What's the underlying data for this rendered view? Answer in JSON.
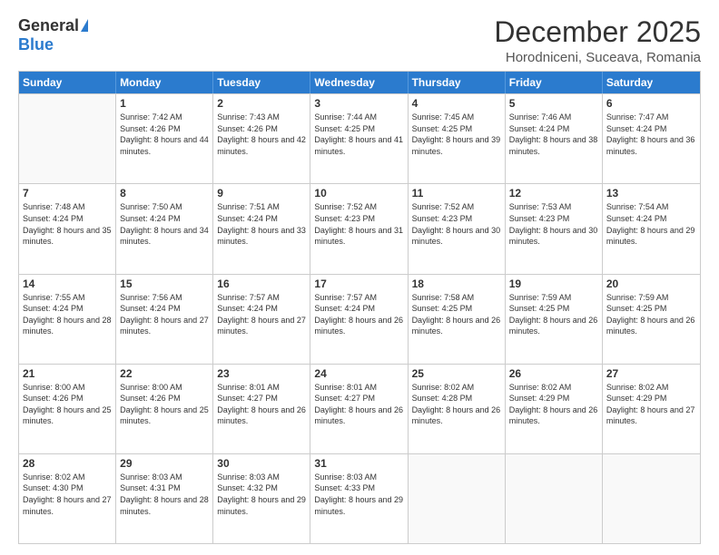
{
  "logo": {
    "general": "General",
    "blue": "Blue"
  },
  "title": "December 2025",
  "subtitle": "Horodniceni, Suceava, Romania",
  "days": [
    "Sunday",
    "Monday",
    "Tuesday",
    "Wednesday",
    "Thursday",
    "Friday",
    "Saturday"
  ],
  "weeks": [
    [
      {
        "day": "",
        "sunrise": "",
        "sunset": "",
        "daylight": ""
      },
      {
        "day": "1",
        "sunrise": "7:42 AM",
        "sunset": "4:26 PM",
        "daylight": "8 hours and 44 minutes."
      },
      {
        "day": "2",
        "sunrise": "7:43 AM",
        "sunset": "4:26 PM",
        "daylight": "8 hours and 42 minutes."
      },
      {
        "day": "3",
        "sunrise": "7:44 AM",
        "sunset": "4:25 PM",
        "daylight": "8 hours and 41 minutes."
      },
      {
        "day": "4",
        "sunrise": "7:45 AM",
        "sunset": "4:25 PM",
        "daylight": "8 hours and 39 minutes."
      },
      {
        "day": "5",
        "sunrise": "7:46 AM",
        "sunset": "4:24 PM",
        "daylight": "8 hours and 38 minutes."
      },
      {
        "day": "6",
        "sunrise": "7:47 AM",
        "sunset": "4:24 PM",
        "daylight": "8 hours and 36 minutes."
      }
    ],
    [
      {
        "day": "7",
        "sunrise": "7:48 AM",
        "sunset": "4:24 PM",
        "daylight": "8 hours and 35 minutes."
      },
      {
        "day": "8",
        "sunrise": "7:50 AM",
        "sunset": "4:24 PM",
        "daylight": "8 hours and 34 minutes."
      },
      {
        "day": "9",
        "sunrise": "7:51 AM",
        "sunset": "4:24 PM",
        "daylight": "8 hours and 33 minutes."
      },
      {
        "day": "10",
        "sunrise": "7:52 AM",
        "sunset": "4:23 PM",
        "daylight": "8 hours and 31 minutes."
      },
      {
        "day": "11",
        "sunrise": "7:52 AM",
        "sunset": "4:23 PM",
        "daylight": "8 hours and 30 minutes."
      },
      {
        "day": "12",
        "sunrise": "7:53 AM",
        "sunset": "4:23 PM",
        "daylight": "8 hours and 30 minutes."
      },
      {
        "day": "13",
        "sunrise": "7:54 AM",
        "sunset": "4:24 PM",
        "daylight": "8 hours and 29 minutes."
      }
    ],
    [
      {
        "day": "14",
        "sunrise": "7:55 AM",
        "sunset": "4:24 PM",
        "daylight": "8 hours and 28 minutes."
      },
      {
        "day": "15",
        "sunrise": "7:56 AM",
        "sunset": "4:24 PM",
        "daylight": "8 hours and 27 minutes."
      },
      {
        "day": "16",
        "sunrise": "7:57 AM",
        "sunset": "4:24 PM",
        "daylight": "8 hours and 27 minutes."
      },
      {
        "day": "17",
        "sunrise": "7:57 AM",
        "sunset": "4:24 PM",
        "daylight": "8 hours and 26 minutes."
      },
      {
        "day": "18",
        "sunrise": "7:58 AM",
        "sunset": "4:25 PM",
        "daylight": "8 hours and 26 minutes."
      },
      {
        "day": "19",
        "sunrise": "7:59 AM",
        "sunset": "4:25 PM",
        "daylight": "8 hours and 26 minutes."
      },
      {
        "day": "20",
        "sunrise": "7:59 AM",
        "sunset": "4:25 PM",
        "daylight": "8 hours and 26 minutes."
      }
    ],
    [
      {
        "day": "21",
        "sunrise": "8:00 AM",
        "sunset": "4:26 PM",
        "daylight": "8 hours and 25 minutes."
      },
      {
        "day": "22",
        "sunrise": "8:00 AM",
        "sunset": "4:26 PM",
        "daylight": "8 hours and 25 minutes."
      },
      {
        "day": "23",
        "sunrise": "8:01 AM",
        "sunset": "4:27 PM",
        "daylight": "8 hours and 26 minutes."
      },
      {
        "day": "24",
        "sunrise": "8:01 AM",
        "sunset": "4:27 PM",
        "daylight": "8 hours and 26 minutes."
      },
      {
        "day": "25",
        "sunrise": "8:02 AM",
        "sunset": "4:28 PM",
        "daylight": "8 hours and 26 minutes."
      },
      {
        "day": "26",
        "sunrise": "8:02 AM",
        "sunset": "4:29 PM",
        "daylight": "8 hours and 26 minutes."
      },
      {
        "day": "27",
        "sunrise": "8:02 AM",
        "sunset": "4:29 PM",
        "daylight": "8 hours and 27 minutes."
      }
    ],
    [
      {
        "day": "28",
        "sunrise": "8:02 AM",
        "sunset": "4:30 PM",
        "daylight": "8 hours and 27 minutes."
      },
      {
        "day": "29",
        "sunrise": "8:03 AM",
        "sunset": "4:31 PM",
        "daylight": "8 hours and 28 minutes."
      },
      {
        "day": "30",
        "sunrise": "8:03 AM",
        "sunset": "4:32 PM",
        "daylight": "8 hours and 29 minutes."
      },
      {
        "day": "31",
        "sunrise": "8:03 AM",
        "sunset": "4:33 PM",
        "daylight": "8 hours and 29 minutes."
      },
      {
        "day": "",
        "sunrise": "",
        "sunset": "",
        "daylight": ""
      },
      {
        "day": "",
        "sunrise": "",
        "sunset": "",
        "daylight": ""
      },
      {
        "day": "",
        "sunrise": "",
        "sunset": "",
        "daylight": ""
      }
    ]
  ]
}
